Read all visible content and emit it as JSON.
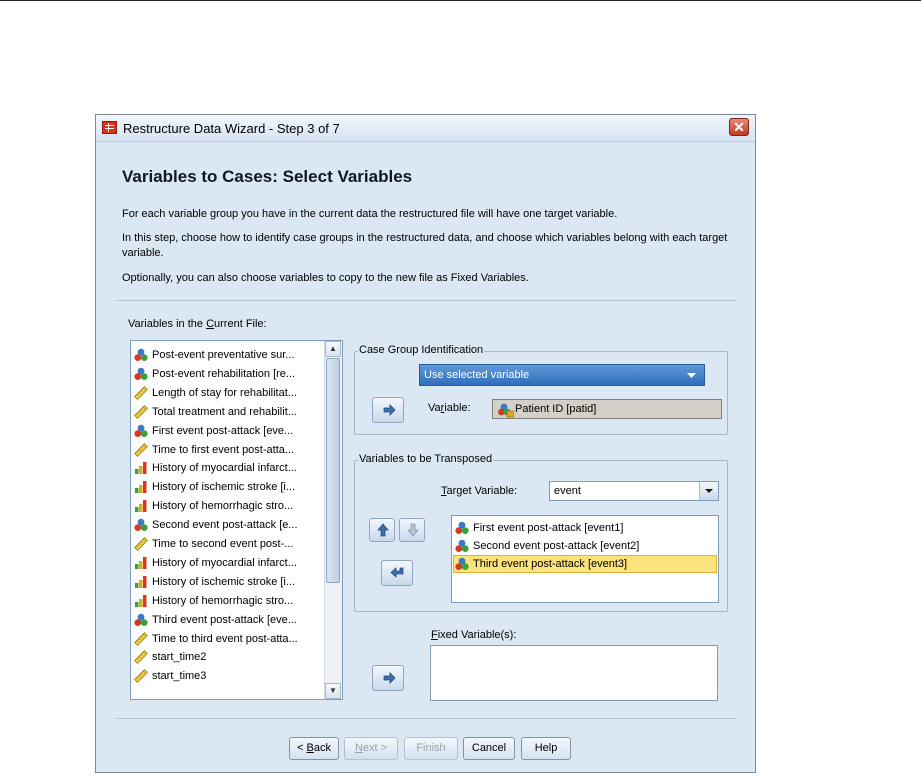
{
  "window": {
    "title": "Restructure Data Wizard - Step 3 of 7",
    "close_symbol": "✕"
  },
  "heading": "Variables to Cases: Select Variables",
  "paragraphs": [
    "For each variable group you have in the current data the restructured file will have one target variable.",
    "In this step, choose how to identify case groups in the restructured data, and choose which variables belong with each target variable.",
    "Optionally, you can also choose variables to copy to the new file as Fixed Variables."
  ],
  "source_list": {
    "label_pre": "Variables in the ",
    "label_key": "C",
    "label_post": "urrent File:",
    "items": [
      {
        "label": "Post-event preventative sur...",
        "icon": "nominal"
      },
      {
        "label": "Post-event rehabilitation [re...",
        "icon": "nominal"
      },
      {
        "label": "Length of stay for rehabilitat...",
        "icon": "scale"
      },
      {
        "label": "Total treatment and rehabilit...",
        "icon": "scale"
      },
      {
        "label": "First event post-attack [eve...",
        "icon": "nominal"
      },
      {
        "label": "Time to first event post-atta...",
        "icon": "scale"
      },
      {
        "label": "History of myocardial infarct...",
        "icon": "ordinal"
      },
      {
        "label": "History of ischemic stroke [i...",
        "icon": "ordinal"
      },
      {
        "label": "History of hemorrhagic stro...",
        "icon": "ordinal"
      },
      {
        "label": "Second event post-attack [e...",
        "icon": "nominal"
      },
      {
        "label": "Time to second event post-...",
        "icon": "scale"
      },
      {
        "label": "History of myocardial infarct...",
        "icon": "ordinal"
      },
      {
        "label": "History of ischemic stroke [i...",
        "icon": "ordinal"
      },
      {
        "label": "History of hemorrhagic stro...",
        "icon": "ordinal"
      },
      {
        "label": "Third event post-attack [eve...",
        "icon": "nominal"
      },
      {
        "label": "Time to third event post-atta...",
        "icon": "scale"
      },
      {
        "label": "start_time2",
        "icon": "scale"
      },
      {
        "label": "start_time3",
        "icon": "scale"
      }
    ]
  },
  "case_group": {
    "title": "Case Group Identification",
    "method": "Use selected variable",
    "variable_label_pre": "Va",
    "variable_label_key": "r",
    "variable_label_post": "iable:",
    "variable_value": "Patient ID [patid]"
  },
  "transposed": {
    "title": "Variables to be Transposed",
    "target_label_key": "T",
    "target_label_post": "arget Variable:",
    "target_value": "event",
    "items": [
      {
        "label": "First event post-attack [event1]",
        "icon": "nominal"
      },
      {
        "label": "Second event post-attack [event2]",
        "icon": "nominal"
      },
      {
        "label": "Third event post-attack [event3]",
        "icon": "nominal"
      }
    ],
    "selected_index": 2
  },
  "fixed": {
    "label_key": "F",
    "label_post": "ixed Variable(s):"
  },
  "footer": {
    "back_pre": "< ",
    "back_key": "B",
    "back_post": "ack",
    "next_key": "N",
    "next_post": "ext >",
    "finish": "Finish",
    "cancel": "Cancel",
    "help": "Help"
  }
}
